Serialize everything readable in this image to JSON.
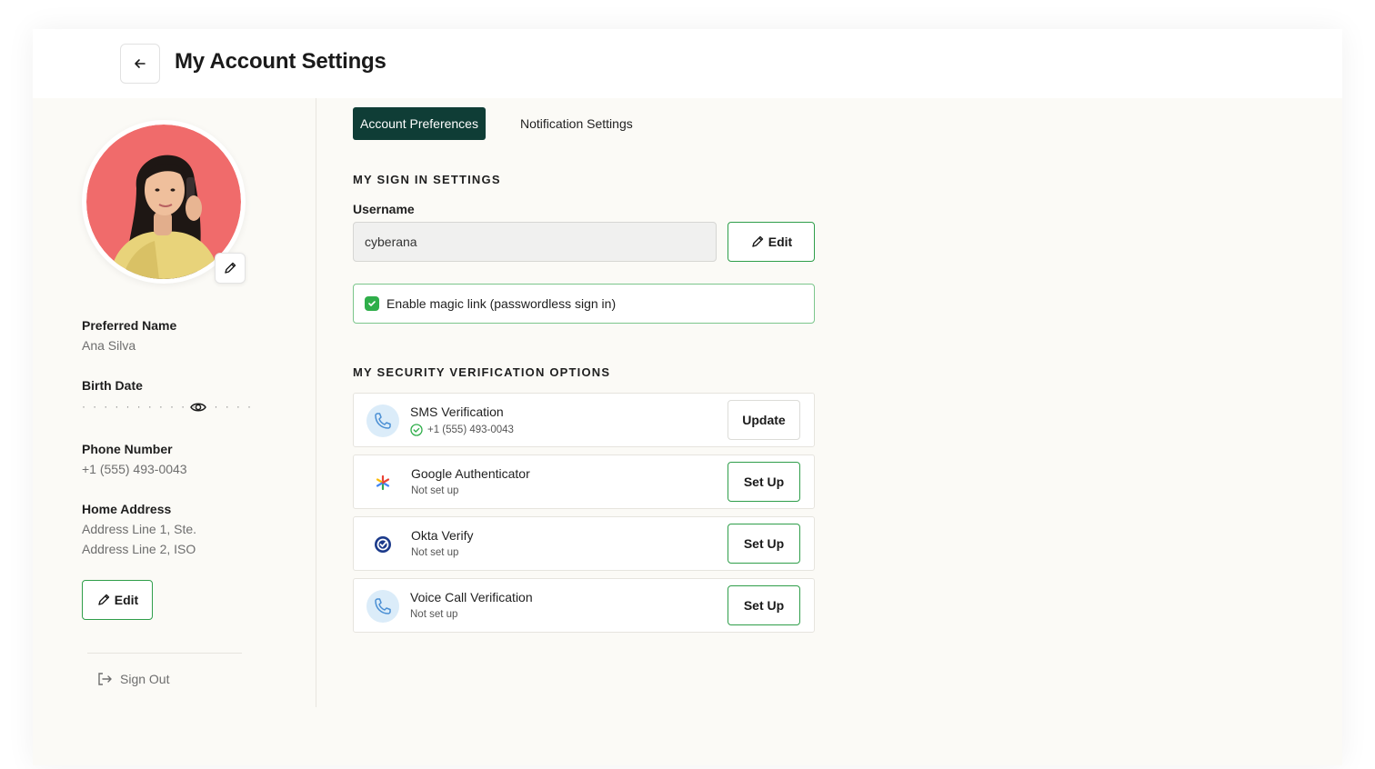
{
  "header": {
    "title": "My Account Settings",
    "back_icon": "arrow-left-icon"
  },
  "profile": {
    "preferred_name_label": "Preferred Name",
    "preferred_name": "Ana Silva",
    "birth_date_label": "Birth Date",
    "birth_date_masked": "· · · · · · · · · · · · · · · ·",
    "phone_label": "Phone Number",
    "phone": "+1 (555) 493-0043",
    "address_label": "Home Address",
    "address_line1": "Address Line 1, Ste.",
    "address_line2": "Address Line 2, ISO",
    "edit_label": "Edit",
    "sign_out_label": "Sign Out"
  },
  "tabs": [
    {
      "label": "Account Preferences",
      "active": true
    },
    {
      "label": "Notification Settings",
      "active": false
    }
  ],
  "sign_in": {
    "section_title": "MY SIGN IN SETTINGS",
    "username_label": "Username",
    "username_value": "cyberana",
    "edit_label": "Edit",
    "magic_link_label": "Enable magic link (passwordless sign in)",
    "magic_link_enabled": true
  },
  "security": {
    "section_title": "MY SECURITY VERIFICATION OPTIONS",
    "options": [
      {
        "name": "SMS Verification",
        "status": "+1 (555) 493-0043",
        "verified": true,
        "action": "Update",
        "icon": "phone-icon"
      },
      {
        "name": "Google Authenticator",
        "status": "Not set up",
        "verified": false,
        "action": "Set Up",
        "icon": "google-authenticator-icon"
      },
      {
        "name": "Okta Verify",
        "status": "Not set up",
        "verified": false,
        "action": "Set Up",
        "icon": "okta-verify-icon"
      },
      {
        "name": "Voice Call Verification",
        "status": "Not set up",
        "verified": false,
        "action": "Set Up",
        "icon": "phone-icon"
      }
    ]
  },
  "colors": {
    "accent_dark": "#0f3d36",
    "success_green": "#2f9e4a",
    "background": "#fbfaf6"
  }
}
